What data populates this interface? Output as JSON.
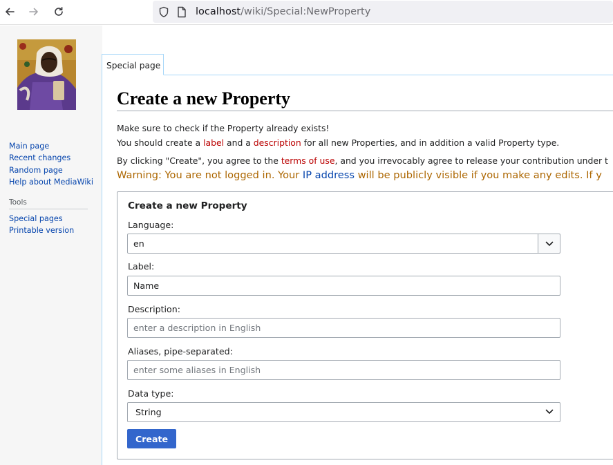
{
  "browser": {
    "url_host": "localhost",
    "url_path": "/wiki/Special:NewProperty"
  },
  "sidebar": {
    "navigation": [
      {
        "label": "Main page"
      },
      {
        "label": "Recent changes"
      },
      {
        "label": "Random page"
      },
      {
        "label": "Help about MediaWiki"
      }
    ],
    "tools_heading": "Tools",
    "tools": [
      {
        "label": "Special pages"
      },
      {
        "label": "Printable version"
      }
    ]
  },
  "tabs": {
    "special_page": "Special page"
  },
  "page": {
    "title": "Create a new Property",
    "intro1": "Make sure to check if the Property already exists!",
    "intro2_a": "You should create a ",
    "intro2_label_link": "label",
    "intro2_b": " and a ",
    "intro2_description_link": "description",
    "intro2_c": " for all new Properties, and in addition a valid Property type.",
    "terms_a": "By clicking \"Create\", you agree to the ",
    "terms_link": "terms of use",
    "terms_b": ", and you irrevocably agree to release your contribution under t",
    "warning_a": "Warning: You are not logged in. Your ",
    "warning_link": "IP address",
    "warning_b": " will be publicly visible if you make any edits. If y"
  },
  "form": {
    "legend": "Create a new Property",
    "language_label": "Language:",
    "language_value": "en",
    "label_label": "Label:",
    "label_value": "Name",
    "description_label": "Description:",
    "description_placeholder": "enter a description in English",
    "aliases_label": "Aliases, pipe-separated:",
    "aliases_placeholder": "enter some aliases in English",
    "datatype_label": "Data type:",
    "datatype_value": "String",
    "create_button": "Create"
  },
  "colors": {
    "link": "#0645ad",
    "redlink": "#ba0000",
    "warning": "#ac6600",
    "primary_button": "#3366cc"
  },
  "icons": {
    "back": "arrow-left-icon",
    "forward": "arrow-right-icon",
    "reload": "reload-icon",
    "shield": "shield-icon",
    "page": "page-icon",
    "chevron": "chevron-down-icon"
  }
}
